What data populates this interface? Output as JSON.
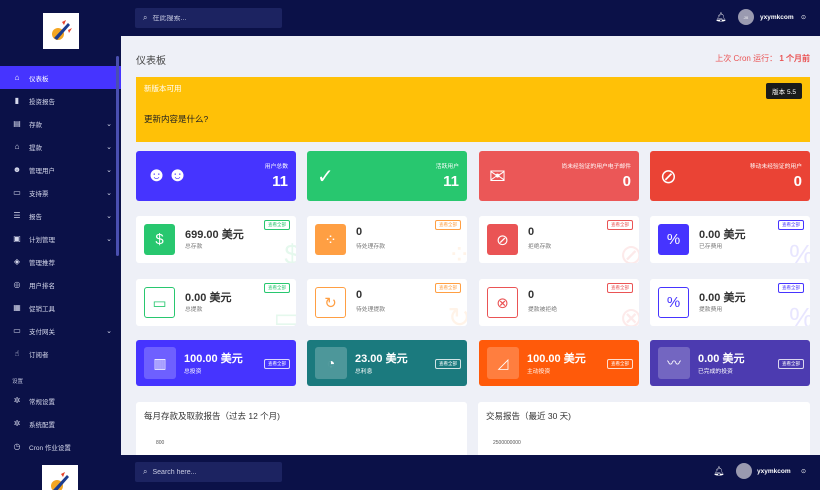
{
  "brand": {
    "logo_icon": "rocket-logo-icon"
  },
  "topbar": {
    "search_placeholder": "在此搜索...",
    "username": "yxymkcom",
    "avatar_initials": "JX"
  },
  "sidebar": {
    "items": [
      {
        "label": "仪表板",
        "icon": "home-icon",
        "caret": ""
      },
      {
        "label": "投资报告",
        "icon": "bar-chart-icon",
        "caret": ""
      },
      {
        "label": "存款",
        "icon": "deposit-icon",
        "caret": "⌄"
      },
      {
        "label": "提款",
        "icon": "bank-icon",
        "caret": "⌄"
      },
      {
        "label": "管理用户",
        "icon": "users-icon",
        "caret": "⌄"
      },
      {
        "label": "支持票",
        "icon": "ticket-icon",
        "caret": "⌄"
      },
      {
        "label": "报告",
        "icon": "list-icon",
        "caret": "⌄"
      },
      {
        "label": "计划管理",
        "icon": "clipboard-icon",
        "caret": "⌄"
      },
      {
        "label": "管理推荐",
        "icon": "bag-icon",
        "caret": ""
      },
      {
        "label": "用户排名",
        "icon": "medal-icon",
        "caret": ""
      },
      {
        "label": "促销工具",
        "icon": "image-icon",
        "caret": ""
      },
      {
        "label": "支付网关",
        "icon": "card-icon",
        "caret": "⌄"
      },
      {
        "label": "订阅者",
        "icon": "thumbs-up-icon",
        "caret": ""
      }
    ],
    "section_label": "设置",
    "settings_items": [
      {
        "label": "常规设置",
        "icon": "gear-icon"
      },
      {
        "label": "系统配置",
        "icon": "cog-icon"
      },
      {
        "label": "Cron 作业设置",
        "icon": "clock-icon"
      }
    ]
  },
  "page": {
    "title": "仪表板",
    "cron_label": "上次 Cron 运行：",
    "cron_value": "1 个月前"
  },
  "alert": {
    "title": "新版本可用",
    "version_button": "版本 5.5",
    "text": "更新内容是什么?"
  },
  "stat_cards": [
    {
      "label": "用户总数",
      "value": "11",
      "icon": "users-group-icon",
      "color": "#4634ff"
    },
    {
      "label": "活跃用户",
      "value": "11",
      "icon": "user-check-icon",
      "color": "#28c76f"
    },
    {
      "label": "尚未经验证的用户电子邮件",
      "value": "0",
      "icon": "envelope-icon",
      "color": "#eb5757"
    },
    {
      "label": "移动未经验证的用户",
      "value": "0",
      "icon": "no-mobile-icon",
      "color": "#ea4335"
    }
  ],
  "finance_cards_row1": [
    {
      "amount": "699.00 美元",
      "sub": "总存款",
      "badge": "查看全部",
      "icon": "hand-dollar-icon",
      "color": "#28c76f"
    },
    {
      "amount": "0",
      "sub": "待处理存款",
      "badge": "查看全部",
      "icon": "spinner-icon",
      "color": "#ff9f43"
    },
    {
      "amount": "0",
      "sub": "拒绝存款",
      "badge": "查看全部",
      "icon": "ban-icon",
      "color": "#ea5455"
    },
    {
      "amount": "0.00 美元",
      "sub": "已存费用",
      "badge": "查看全部",
      "icon": "percent-icon",
      "color": "#4634ff"
    }
  ],
  "finance_cards_row2": [
    {
      "amount": "0.00 美元",
      "sub": "总提款",
      "badge": "查看全部",
      "icon": "wallet-icon",
      "color": "#28c76f"
    },
    {
      "amount": "0",
      "sub": "待处理提款",
      "badge": "查看全部",
      "icon": "sync-icon",
      "color": "#ff9f43"
    },
    {
      "amount": "0",
      "sub": "提款被拒绝",
      "badge": "查看全部",
      "icon": "x-circle-icon",
      "color": "#ea5455"
    },
    {
      "amount": "0.00 美元",
      "sub": "提款费用",
      "badge": "查看全部",
      "icon": "percent-icon",
      "color": "#4634ff"
    }
  ],
  "invest_cards": [
    {
      "amount": "100.00 美元",
      "sub": "总投资",
      "badge": "查看全部",
      "icon": "chart-bars-icon",
      "color": "#4634ff"
    },
    {
      "amount": "23.00 美元",
      "sub": "总利息",
      "badge": "查看全部",
      "icon": "pie-chart-icon",
      "color": "#1b7a7e"
    },
    {
      "amount": "100.00 美元",
      "sub": "主动投资",
      "badge": "查看全部",
      "icon": "area-chart-icon",
      "color": "#ff5a0a"
    },
    {
      "amount": "0.00 美元",
      "sub": "已完成的投资",
      "badge": "查看全部",
      "icon": "line-chart-icon",
      "color": "#4c3bb0"
    }
  ],
  "charts": [
    {
      "title": "每月存款及取款报告（过去 12 个月)",
      "axis_top": "800"
    },
    {
      "title": "交易报告（最近 30 天)",
      "axis_top": "2500000000"
    }
  ],
  "footer": {
    "search_placeholder": "Search here...",
    "username": "yxymkcom"
  }
}
